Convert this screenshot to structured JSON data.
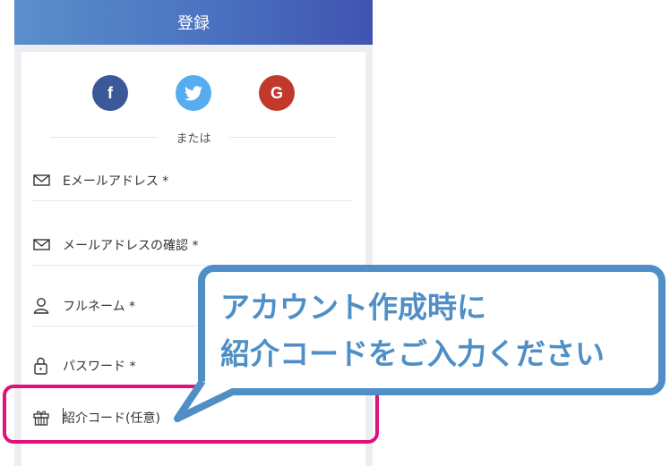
{
  "header": {
    "title": "登録"
  },
  "social": {
    "facebook_icon": "facebook-icon",
    "twitter_icon": "twitter-icon",
    "google_icon": "google-icon",
    "facebook_glyph": "f",
    "google_glyph": "G"
  },
  "divider": {
    "or_text": "または"
  },
  "form": {
    "email_label": "Eメールアドレス *",
    "email_confirm_label": "メールアドレスの確認 *",
    "fullname_label": "フルネーム *",
    "password_label": "パスワード *",
    "referral_label": "紹介コード(任意)"
  },
  "callout": {
    "line1": "アカウント作成時に",
    "line2": "紹介コードをご入力ください"
  },
  "colors": {
    "header_gradient_start": "#5b8fcb",
    "header_gradient_end": "#4053b0",
    "facebook": "#3b5998",
    "twitter": "#55acee",
    "google": "#c0392b",
    "highlight": "#e0117b",
    "callout": "#4f8fc6"
  }
}
